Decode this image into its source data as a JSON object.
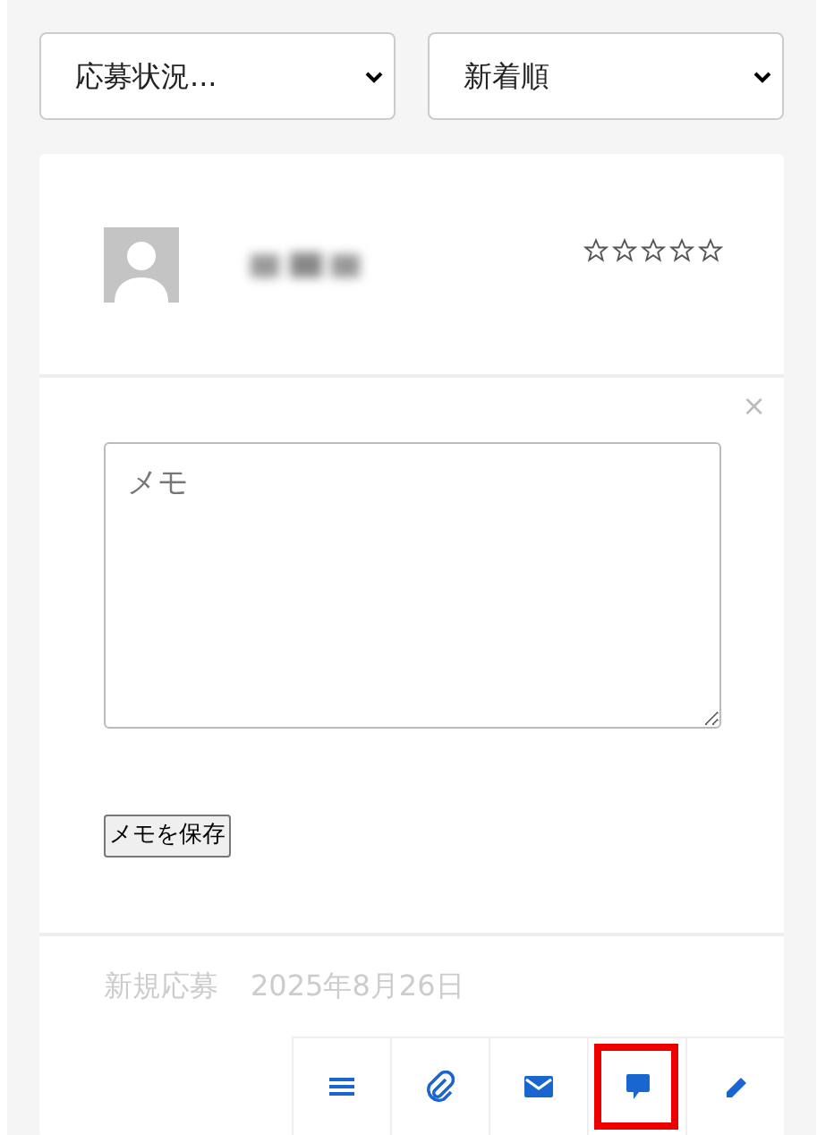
{
  "filters": [
    {
      "value": "応募状況..."
    },
    {
      "value": "新着順"
    }
  ],
  "applicant": {
    "stars": 0
  },
  "memo": {
    "close": "×",
    "placeholder": "メモ",
    "save_button": "メモを保存"
  },
  "status": "新規応募",
  "date": "2025年8月26日",
  "actions": [
    {
      "kind": "list",
      "highlighted": false
    },
    {
      "kind": "attach",
      "highlighted": false
    },
    {
      "kind": "mail",
      "highlighted": false
    },
    {
      "kind": "comment",
      "highlighted": true
    },
    {
      "kind": "edit",
      "highlighted": false
    }
  ]
}
